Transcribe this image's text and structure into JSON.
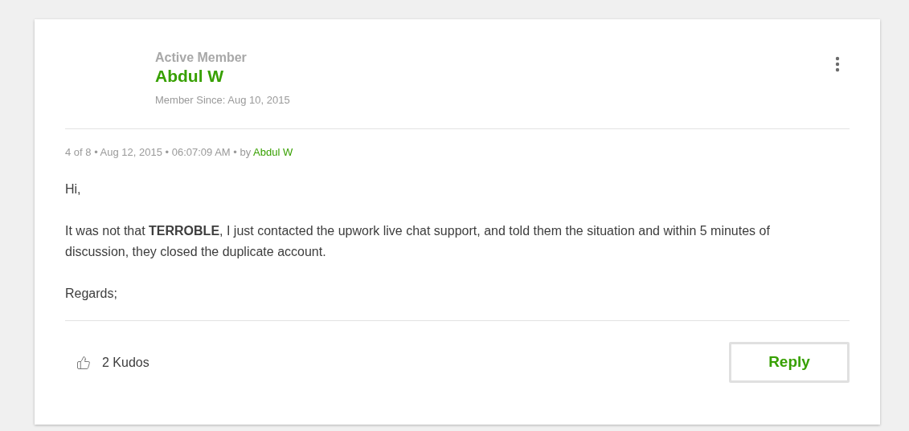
{
  "author": {
    "rank": "Active Member",
    "name": "Abdul W",
    "member_since": "Member Since: Aug 10, 2015"
  },
  "meta": {
    "text": "4 of 8 • Aug 12, 2015 • 06:07:09 AM • by ",
    "author_link": "Abdul W"
  },
  "body": [
    "Hi,",
    "It was not that **TERROBLE**, I just contacted the upwork live chat support, and told them the situation and within 5 minutes of discussion, they closed the duplicate account.",
    "Regards;"
  ],
  "kudos": {
    "label": "2 Kudos"
  },
  "reply_button": "Reply"
}
